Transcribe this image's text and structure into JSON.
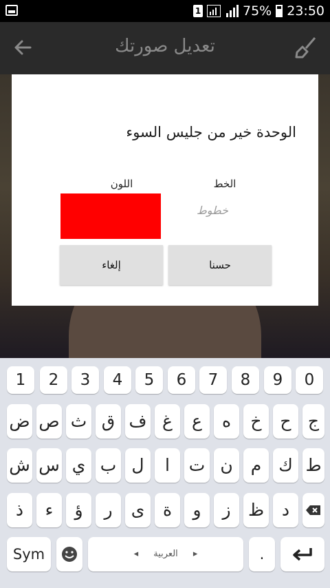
{
  "status_bar": {
    "sim_label": "1",
    "battery_text": "75%",
    "time": "23:50"
  },
  "app_bar": {
    "title": "تعديل صورتك",
    "back_icon": "arrow-left-icon",
    "brush_icon": "brush-icon"
  },
  "dialog": {
    "message": "الوحدة خير من جليس السوء",
    "font_label": "الخط",
    "color_label": "اللون",
    "font_preview": "خطوط",
    "color_value": "#ff0000",
    "ok_button": "حسنا",
    "cancel_button": "إلغاء"
  },
  "keyboard": {
    "numbers": [
      "1",
      "2",
      "3",
      "4",
      "5",
      "6",
      "7",
      "8",
      "9",
      "0"
    ],
    "row1": [
      "ض",
      "ص",
      "ث",
      "ق",
      "ف",
      "غ",
      "ع",
      "ه",
      "خ",
      "ح",
      "ج"
    ],
    "row2": [
      "ش",
      "س",
      "ي",
      "ب",
      "ل",
      "ا",
      "ت",
      "ن",
      "م",
      "ك",
      "ط"
    ],
    "row3": [
      "ذ",
      "ء",
      "ؤ",
      "ر",
      "ى",
      "ة",
      "و",
      "ز",
      "ظ",
      "د"
    ],
    "sym_label": "Sym",
    "space_label": "العربية",
    "period_label": "."
  }
}
